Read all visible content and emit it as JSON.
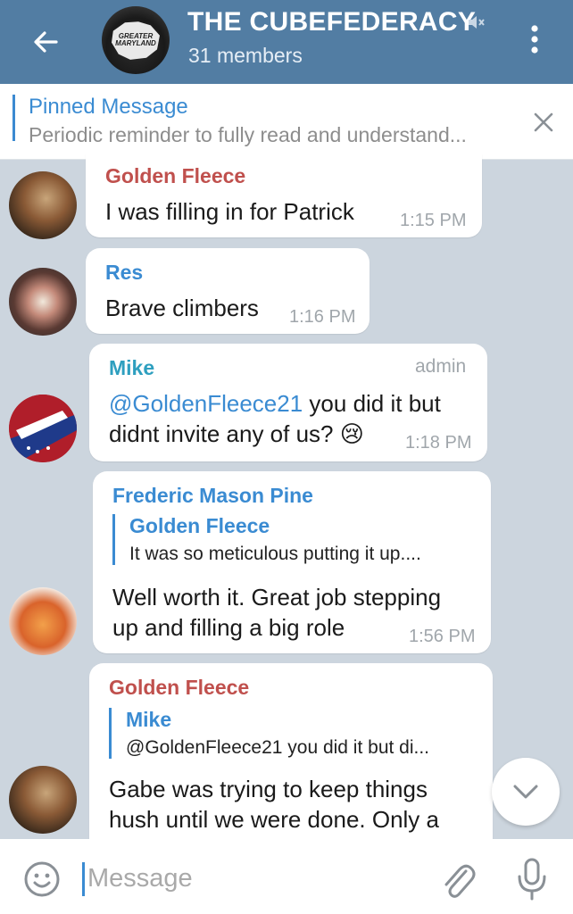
{
  "header": {
    "title": "THE CUBEFEDERACY",
    "members": "31 members",
    "avatar_text": "GREATER MARYLAND"
  },
  "pinned": {
    "label": "Pinned Message",
    "text": "Periodic reminder to fully read and understand..."
  },
  "messages": [
    {
      "sender": "Golden Fleece",
      "sender_color": "#c0504d",
      "text": "I was filling in for Patrick",
      "time": "1:15 PM"
    },
    {
      "sender": "Res",
      "sender_color": "#3a8bd2",
      "text": "Brave climbers",
      "time": "1:16 PM"
    },
    {
      "sender": "Mike",
      "sender_color": "#2e9fbf",
      "badge": "admin",
      "mention": "@GoldenFleece21",
      "text_line1_rest": " you did it but",
      "text_line2": "didnt invite any of us?",
      "emoji": "😢",
      "time": "1:18 PM"
    },
    {
      "sender": "Frederic Mason Pine",
      "sender_color": "#3a8bd2",
      "reply": {
        "name": "Golden Fleece",
        "text": "It was so meticulous putting it up...."
      },
      "text_line1": "Well worth it. Great job stepping",
      "text_line2": "up and filling a big role",
      "time": "1:56 PM"
    },
    {
      "sender": "Golden Fleece",
      "sender_color": "#c0504d",
      "reply": {
        "name": "Mike",
        "text": "@GoldenFleece21 you did it but di..."
      },
      "text_line1": "Gabe was trying to keep things",
      "text_line2": "hush until we were done. Only a"
    }
  ],
  "input": {
    "placeholder": "Message"
  },
  "colors": {
    "header": "#527da3",
    "accent": "#3a8bd2",
    "background": "#ccd5de"
  },
  "icons": [
    "back-arrow-icon",
    "mute-icon",
    "menu-dots-icon",
    "close-icon",
    "chevron-down-icon",
    "emoji-icon",
    "attach-icon",
    "mic-icon"
  ]
}
